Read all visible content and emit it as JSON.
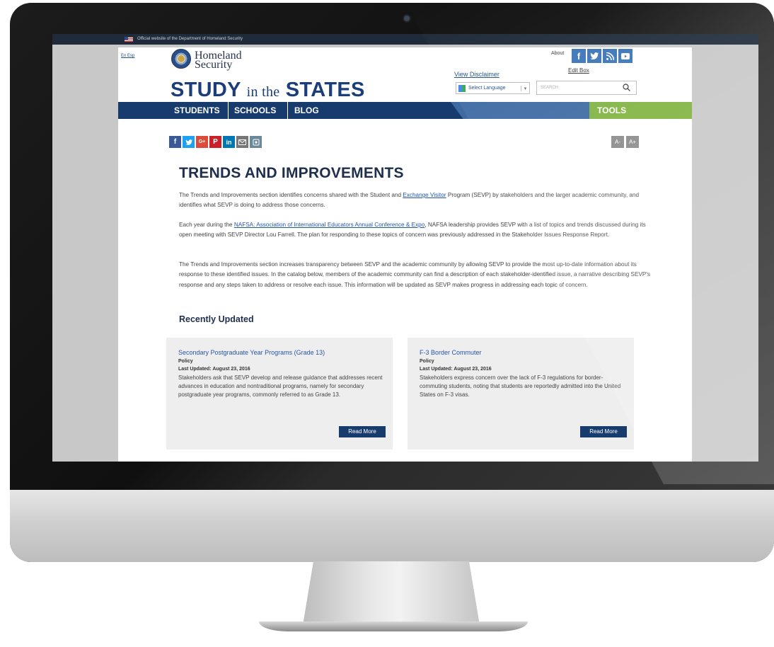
{
  "gov_banner": {
    "text": "Official website of the Department of Homeland Security"
  },
  "header": {
    "lang_tiny": "En Esp",
    "dhs_line1": "Homeland",
    "dhs_line2": "Security",
    "site_title": {
      "part1": "STUDY",
      "part2": "in the",
      "part3": "STATES"
    },
    "about_link": "About",
    "edit_box": "Edit Box",
    "view_disclaimer": "View Disclaimer",
    "select_language": "Select Language",
    "search_placeholder": "SEARCH"
  },
  "nav": {
    "students": "STUDENTS",
    "schools": "SCHOOLS",
    "blog": "BLOG",
    "tools": "TOOLS"
  },
  "socials": [
    "f",
    "t",
    "rss",
    "yt"
  ],
  "font_controls": {
    "decrease": "A-",
    "increase": "A+"
  },
  "content": {
    "title": "TRENDS AND IMPROVEMENTS",
    "p1_a": "The Trends and Improvements section identifies concerns shared with the Student and ",
    "p1_link": "Exchange Visitor",
    "p1_b": " Program (SEVP) by stakeholders and the larger academic community, and identifies what SEVP is doing to address those concerns.",
    "p2_a": "Each year during the ",
    "p2_link": "NAFSA: Association of International Educators Annual Conference & Expo",
    "p2_b": ", NAFSA leadership provides SEVP with a list of topics and trends discussed during its open meeting with SEVP Director Lou Farrell. The plan for responding to these topics of concern was previously addressed in the Stakeholder Issues Response Report.",
    "p3": "The Trends and Improvements section increases transparency between SEVP and the academic community by allowing SEVP to provide the most up-to-date information about its response to these identified issues. In the catalog below, members of the academic community can find a description of each stakeholder-identified issue, a narrative describing SEVP's response and any steps taken to address or resolve each issue. This information will be updated as SEVP makes progress in addressing each topic of concern.",
    "recently_updated": "Recently Updated"
  },
  "cards": [
    {
      "title": "Secondary Postgraduate Year Programs (Grade 13)",
      "category": "Policy",
      "date": "Last Updated: August 23, 2016",
      "description": "Stakeholders ask that SEVP develop and release guidance that addresses recent advances in education and nontraditional programs, namely for secondary postgraduate year programs, commonly referred to as Grade 13.",
      "button": "Read More"
    },
    {
      "title": "F-3 Border Commuter",
      "category": "Policy",
      "date": "Last Updated: August 23, 2016",
      "description": "Stakeholders express concern over the lack of F-3 regulations for border-commuting students, noting that students are reportedly admitted into the United States on F-3 visas.",
      "button": "Read More"
    }
  ],
  "colors": {
    "navy": "#173b6d",
    "nav_mid": "#3d6aa3",
    "tools_green": "#7fb33f",
    "link_blue": "#2356a8",
    "social_blue": "#3b74b9"
  }
}
